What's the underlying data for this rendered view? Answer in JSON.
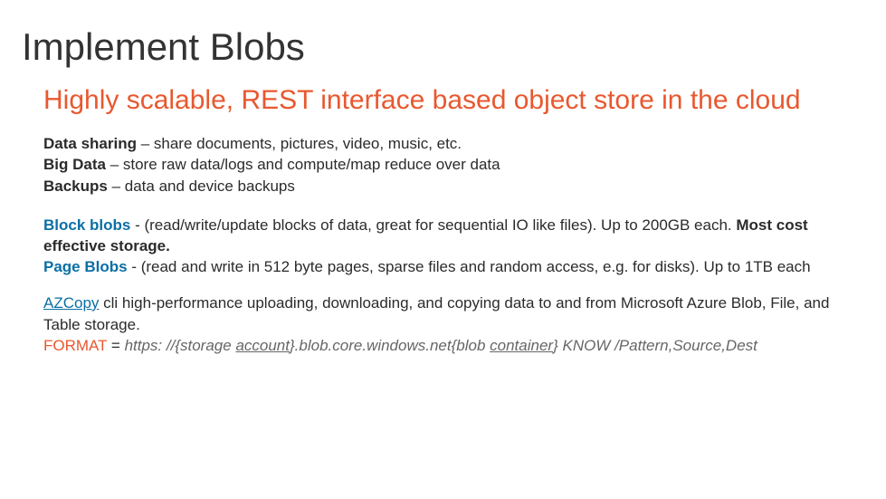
{
  "title": "Implement Blobs",
  "subtitle": "Highly scalable, REST interface based object store in the cloud",
  "usecases": {
    "line1_label": "Data sharing",
    "line1_desc": " – share documents, pictures, video, music, etc.",
    "line2_label": "Big Data",
    "line2_desc": " – store raw data/logs and compute/map reduce over data",
    "line3_label": "Backups",
    "line3_desc": " – data and device backups"
  },
  "blobtypes": {
    "block_label": "Block blobs",
    "block_desc1": " -  (read/write/update blocks of data, great for sequential IO like files). Up to 200GB each. ",
    "block_desc2": "Most cost effective storage.",
    "page_label": "Page Blobs",
    "page_desc": " - (read and write in 512 byte pages, sparse files and random access, e.g. for disks). Up to 1TB each"
  },
  "azcopy": {
    "label": "AZCopy",
    "desc": " cli  high-performance uploading, downloading, and copying data to and from Microsoft Azure Blob, File, and Table storage.",
    "format_label": "FORMAT",
    "eq": " = ",
    "url_prefix": "https: //{storage ",
    "url_account": "account",
    "url_mid": "}.blob.core.windows.net{blob ",
    "url_container": "container",
    "url_suffix": "} KNOW /Pattern,Source,Dest"
  }
}
